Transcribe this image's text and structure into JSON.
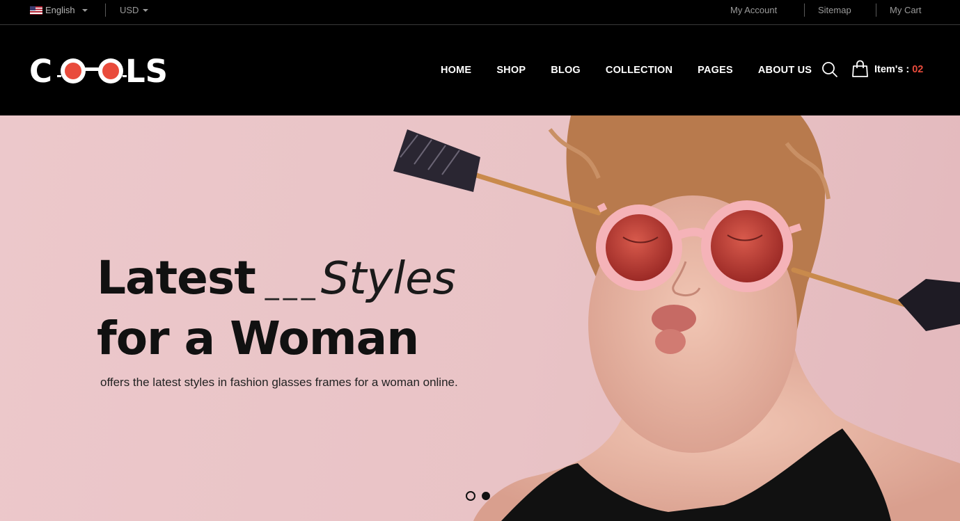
{
  "topbar": {
    "language": "English",
    "currency": "USD",
    "links": [
      "My Account",
      "Sitemap",
      "My Cart"
    ]
  },
  "header": {
    "logo_text": "COOLS",
    "nav": [
      "HOME",
      "SHOP",
      "BLOG",
      "COLLECTION",
      "PAGES",
      "ABOUT US"
    ],
    "cart_label": "Item's :",
    "cart_count": "02"
  },
  "hero": {
    "headline_bold": "Latest",
    "headline_dashes": "___",
    "headline_italic": "Styles",
    "headline_line2": "for a Woman",
    "subtext": "offers the latest styles in fashion glasses frames for a woman online.",
    "slides": 2,
    "active_slide": 2
  },
  "colors": {
    "accent": "#e94b3c",
    "hero_bg": "#ecc8cb",
    "header_bg": "#000000"
  },
  "icons": [
    "flag-us-icon",
    "caret-down-icon",
    "search-icon",
    "shopping-bag-icon"
  ]
}
